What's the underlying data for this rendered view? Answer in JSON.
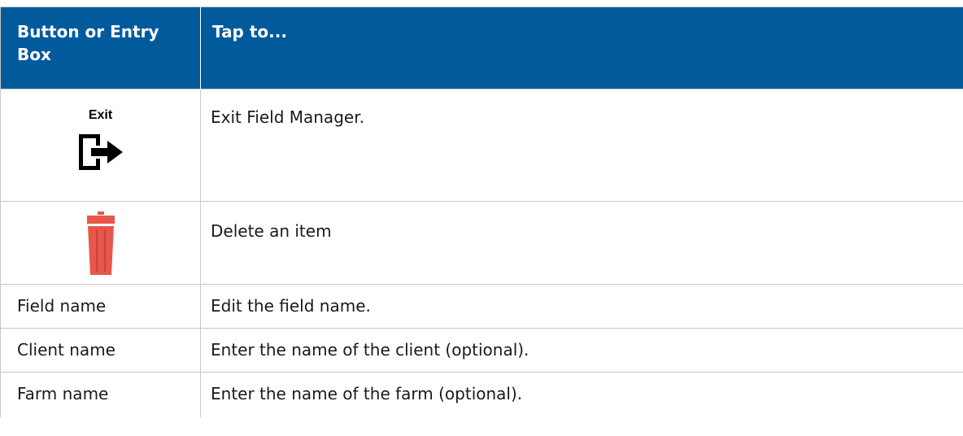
{
  "header": {
    "col1": "Button or Entry Box",
    "col2": "Tap to..."
  },
  "rows": [
    {
      "button_label": "Exit",
      "icon": "exit-icon",
      "description": "Exit Field Manager."
    },
    {
      "icon": "trash-icon",
      "description": "Delete an item"
    },
    {
      "entry": "Field name",
      "description": "Edit the field name."
    },
    {
      "entry": "Client name",
      "description": "Enter the name of the client (optional)."
    },
    {
      "entry": "Farm name",
      "description": "Enter the name of the farm (optional)."
    }
  ],
  "colors": {
    "header_bg": "#005a9c",
    "header_text": "#ffffff",
    "trash_red": "#e8574b",
    "border": "#c9c9c9"
  }
}
